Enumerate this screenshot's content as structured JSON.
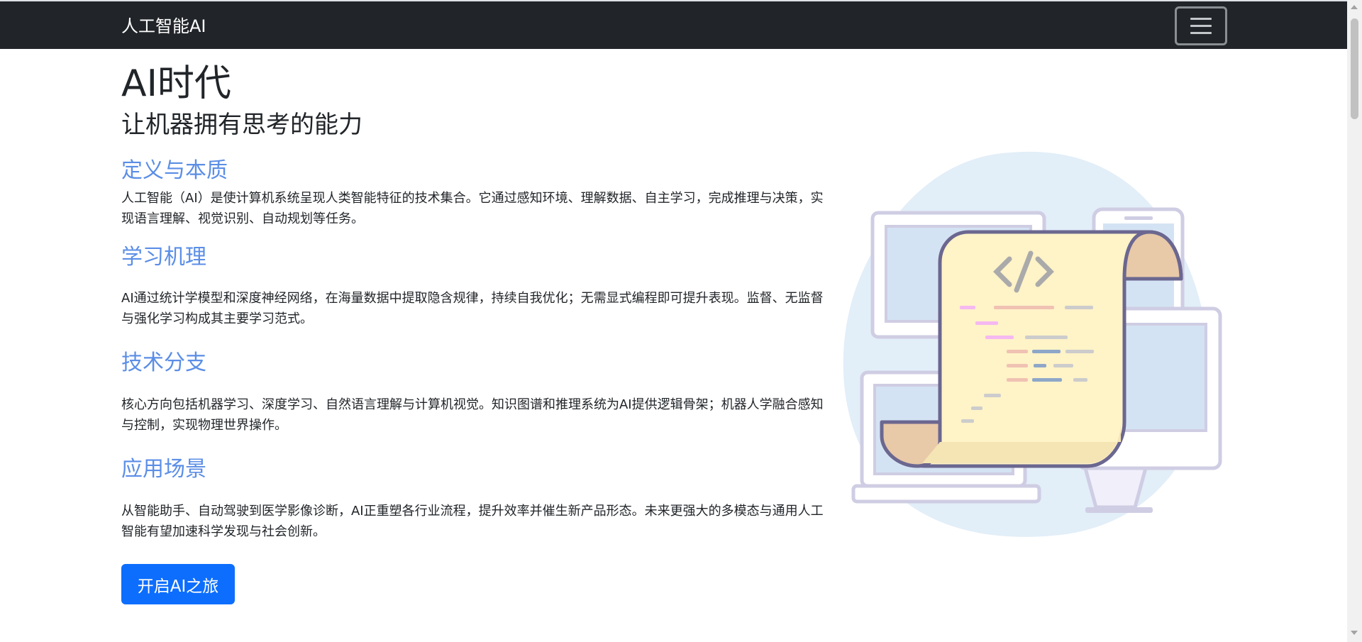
{
  "navbar": {
    "brand": "人工智能AI"
  },
  "hero": {
    "title": "AI时代",
    "subtitle": "让机器拥有思考的能力"
  },
  "sections": [
    {
      "title": "定义与本质",
      "text": "人工智能（AI）是使计算机系统呈现人类智能特征的技术集合。它通过感知环境、理解数据、自主学习，完成推理与决策，实现语言理解、视觉识别、自动规划等任务。"
    },
    {
      "title": "学习机理",
      "text": "AI通过统计学模型和深度神经网络，在海量数据中提取隐含规律，持续自我优化；无需显式编程即可提升表现。监督、无监督与强化学习构成其主要学习范式。"
    },
    {
      "title": "技术分支",
      "text": "核心方向包括机器学习、深度学习、自然语言理解与计算机视觉。知识图谱和推理系统为AI提供逻辑骨架；机器人学融合感知与控制，实现物理世界操作。"
    },
    {
      "title": "应用场景",
      "text": "从智能助手、自动驾驶到医学影像诊断，AI正重塑各行业流程，提升效率并催生新产品形态。未来更强大的多模态与通用人工智能有望加速科学发现与社会创新。"
    }
  ],
  "cta": {
    "label": "开启AI之旅"
  },
  "icons": {
    "menu": "hamburger-menu-icon",
    "illustration": "code-scroll-devices-illustration"
  },
  "colors": {
    "navbar_bg": "#212529",
    "accent_heading": "#5b8ee6",
    "button_primary": "#0d6efd"
  }
}
